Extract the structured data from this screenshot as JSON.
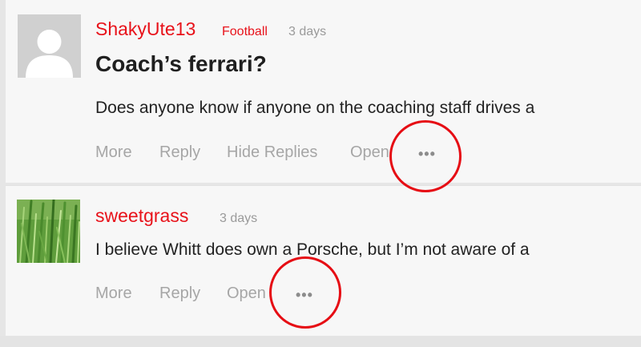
{
  "posts": [
    {
      "username": "ShakyUte13",
      "category": "Football",
      "time": "3 days",
      "title": "Coach’s ferrari?",
      "body": "Does anyone know if anyone on the coaching staff drives a",
      "actions": [
        "More",
        "Reply",
        "Hide Replies",
        "Open"
      ],
      "overflow_icon": "ellipsis-icon"
    },
    {
      "username": "sweetgrass",
      "time": "3 days",
      "body": "I believe Whitt does own a Porsche, but I’m not aware of a",
      "actions": [
        "More",
        "Reply",
        "Open"
      ],
      "overflow_icon": "ellipsis-icon"
    }
  ],
  "colors": {
    "accent": "#e8121a",
    "annotation_circle": "#e60d14",
    "muted_text": "#a6a6a6",
    "card_bg": "#f7f7f7"
  }
}
